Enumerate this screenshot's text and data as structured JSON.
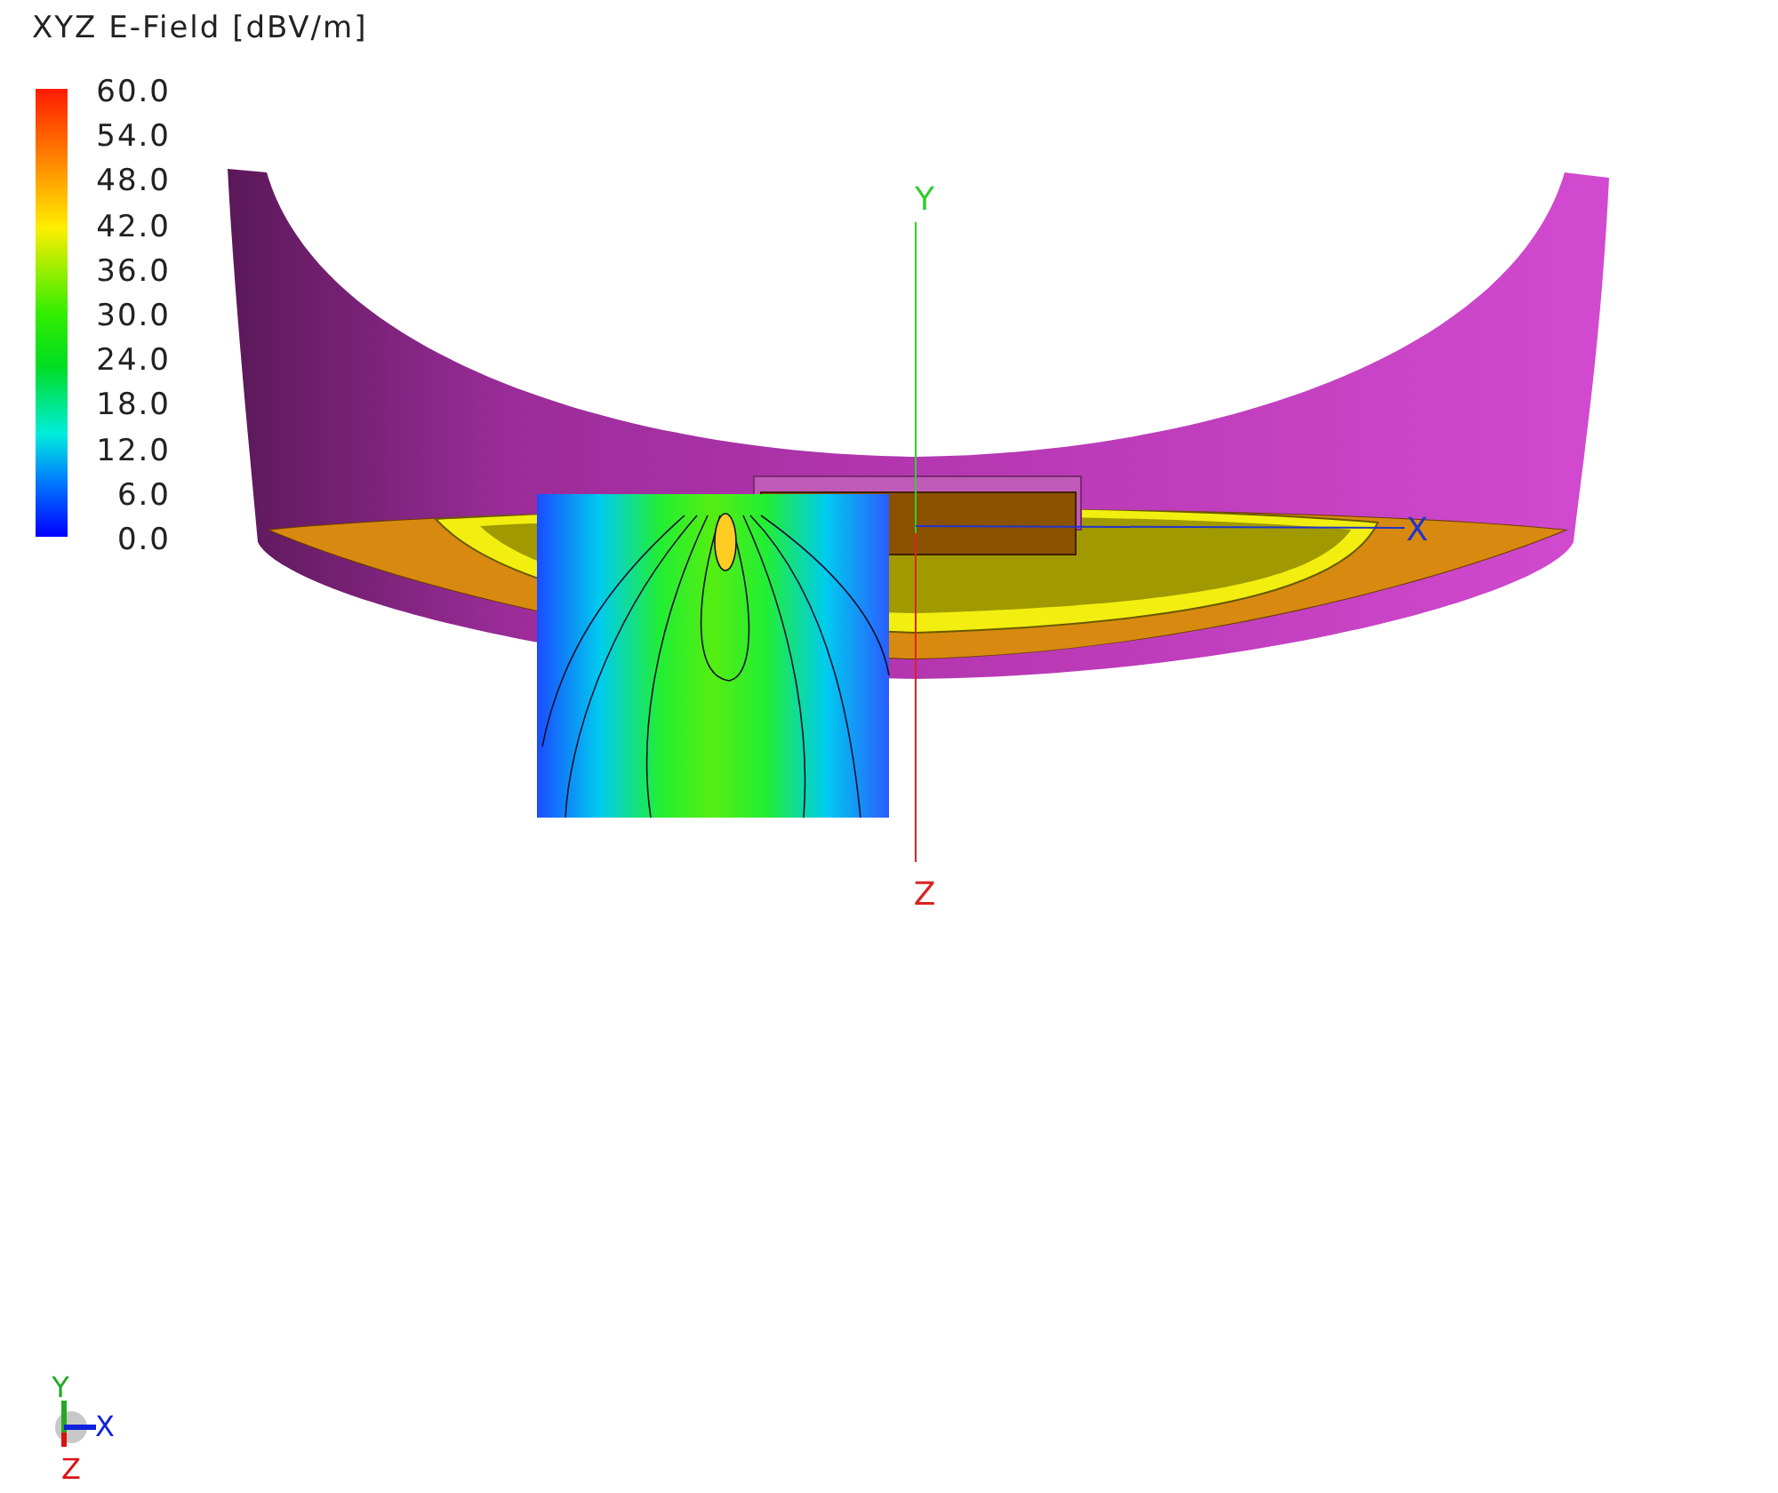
{
  "legend": {
    "title": "XYZ E-Field [dBV/m]",
    "labels": [
      "60.0",
      "54.0",
      "48.0",
      "42.0",
      "36.0",
      "30.0",
      "24.0",
      "18.0",
      "12.0",
      "6.0",
      "0.0"
    ]
  },
  "axes": [
    {
      "label": "Y",
      "color": "#33cc33"
    },
    {
      "label": "X",
      "color": "#2233cc"
    },
    {
      "label": "Z",
      "color": "#dd2222"
    }
  ],
  "triad": [
    {
      "label": "Y",
      "color": "#22aa22"
    },
    {
      "label": "X",
      "color": "#1122dd"
    },
    {
      "label": "Z",
      "color": "#dd1111"
    }
  ]
}
